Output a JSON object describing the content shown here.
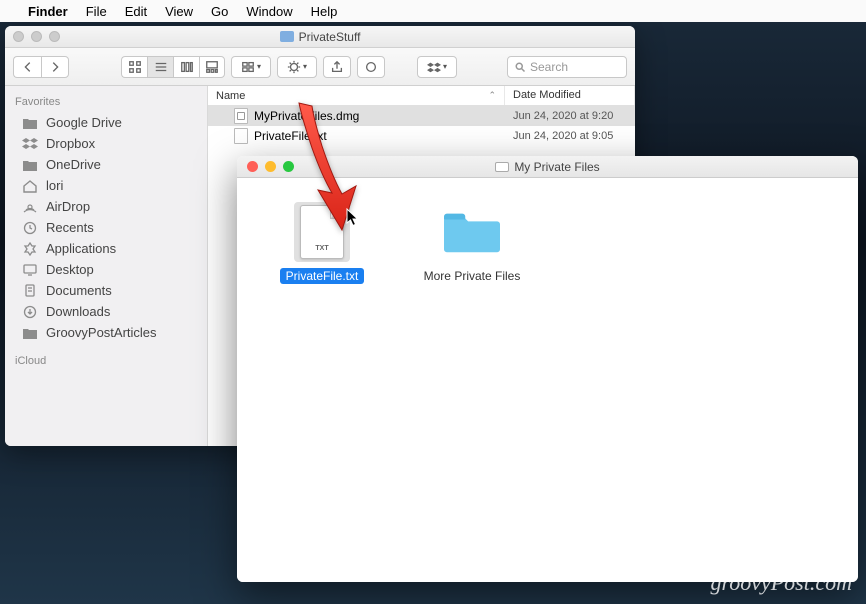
{
  "menubar": {
    "app": "Finder",
    "items": [
      "File",
      "Edit",
      "View",
      "Go",
      "Window",
      "Help"
    ]
  },
  "win1": {
    "title": "PrivateStuff",
    "search_placeholder": "Search",
    "columns": {
      "name": "Name",
      "date": "Date Modified"
    },
    "rows": [
      {
        "name": "MyPrivateFiles.dmg",
        "date": "Jun 24, 2020 at 9:20",
        "selected": true,
        "kind": "dmg"
      },
      {
        "name": "PrivateFile.txt",
        "date": "Jun 24, 2020 at 9:05",
        "selected": false,
        "kind": "txt"
      }
    ],
    "sidebar": {
      "favorites_h": "Favorites",
      "icloud_h": "iCloud",
      "items": [
        {
          "label": "Google Drive",
          "icon": "folder"
        },
        {
          "label": "Dropbox",
          "icon": "dropbox"
        },
        {
          "label": "OneDrive",
          "icon": "folder"
        },
        {
          "label": "lori",
          "icon": "home"
        },
        {
          "label": "AirDrop",
          "icon": "airdrop"
        },
        {
          "label": "Recents",
          "icon": "clock"
        },
        {
          "label": "Applications",
          "icon": "apps"
        },
        {
          "label": "Desktop",
          "icon": "desktop"
        },
        {
          "label": "Documents",
          "icon": "docs"
        },
        {
          "label": "Downloads",
          "icon": "download"
        },
        {
          "label": "GroovyPostArticles",
          "icon": "folder"
        }
      ]
    }
  },
  "win2": {
    "title": "My Private Files",
    "items": [
      {
        "label": "PrivateFile.txt",
        "kind": "txt",
        "selected": true
      },
      {
        "label": "More Private Files",
        "kind": "folder",
        "selected": false
      }
    ]
  },
  "watermark": "groovyPost.com"
}
